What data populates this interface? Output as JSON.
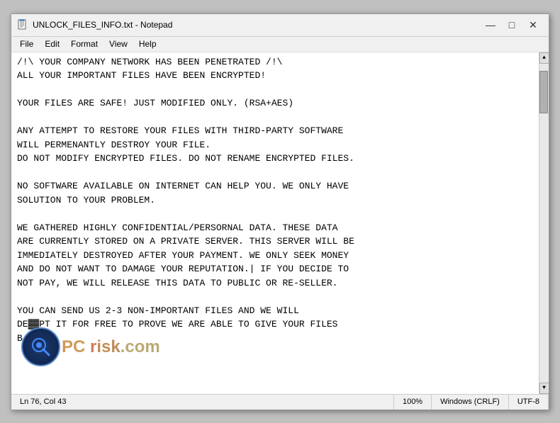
{
  "window": {
    "title": "UNLOCK_FILES_INFO.txt - Notepad",
    "icon": "notepad"
  },
  "menu": {
    "items": [
      "File",
      "Edit",
      "Format",
      "View",
      "Help"
    ]
  },
  "content": "/!\\ YOUR COMPANY NETWORK HAS BEEN PENETRATED /!\\\nALL YOUR IMPORTANT FILES HAVE BEEN ENCRYPTED!\n\nYOUR FILES ARE SAFE! JUST MODIFIED ONLY. (RSA+AES)\n\nANY ATTEMPT TO RESTORE YOUR FILES WITH THIRD-PARTY SOFTWARE\nWILL PERMENANTLY DESTROY YOUR FILE.\nDO NOT MODIFY ENCRYPTED FILES. DO NOT RENAME ENCRYPTED FILES.\n\nNO SOFTWARE AVAILABLE ON INTERNET CAN HELP YOU. WE ONLY HAVE\nSOLUTION TO YOUR PROBLEM.\n\nWE GATHERED HIGHLY CONFIDENTIAL/PERSORNAL DATA. THESE DATA\nARE CURRENTLY STORED ON A PRIVATE SERVER. THIS SERVER WILL BE\nIMMEDIATELY DESTROYED AFTER YOUR PAYMENT. WE ONLY SEEK MONEY\nAND DO NOT WANT TO DAMAGE YOUR REPUTATION.| IF YOU DECIDE TO\nNOT PAY, WE WILL RELEASE THIS DATA TO PUBLIC OR RE-SELLER.\n\nYOU CAN SEND US 2-3 NON-IMPORTANT FILES AND WE WILL\nDE▓▓PT IT FOR FREE TO PROVE WE ARE ABLE TO GIVE YOUR FILES\nB",
  "statusbar": {
    "position": "Ln 76, Col 43",
    "zoom": "100%",
    "line_endings": "Windows (CRLF)",
    "encoding": "UTF-8"
  },
  "title_buttons": {
    "minimize": "—",
    "maximize": "□",
    "close": "✕"
  }
}
